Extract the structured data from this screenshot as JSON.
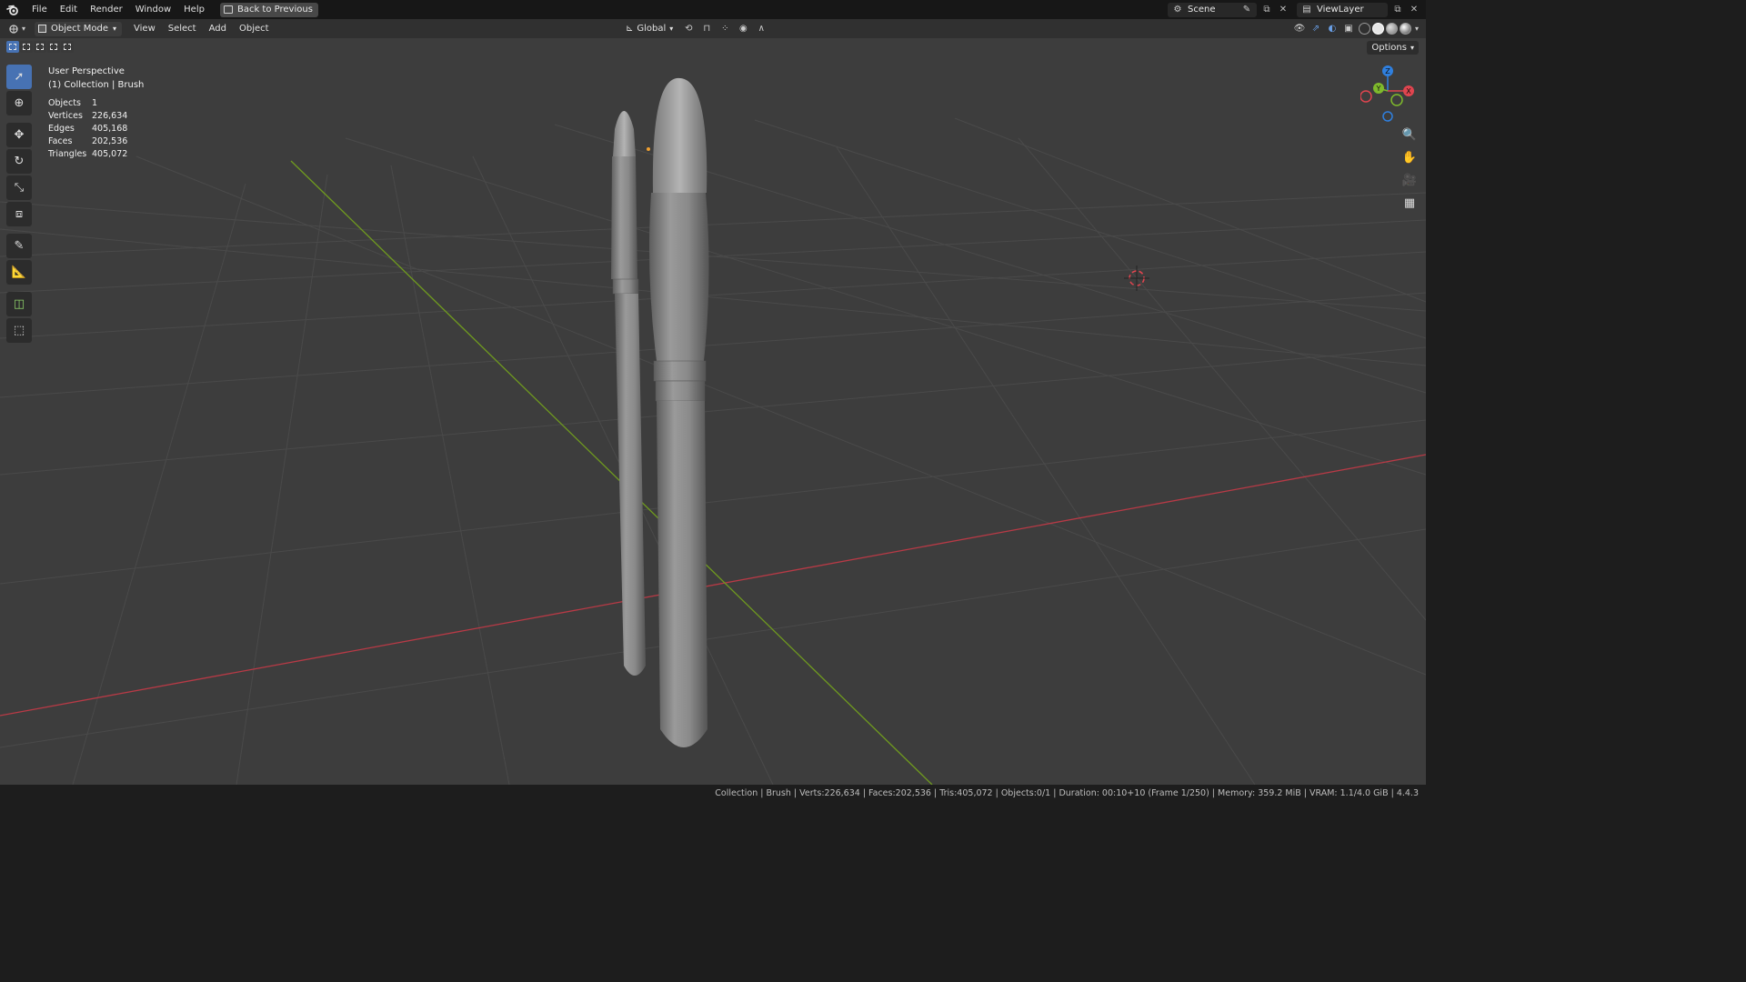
{
  "menubar": {
    "items": [
      "File",
      "Edit",
      "Render",
      "Window",
      "Help"
    ],
    "back_button": "Back to Previous",
    "scene_name": "Scene",
    "view_layer": "ViewLayer"
  },
  "viewport_header": {
    "mode": "Object Mode",
    "menus": [
      "View",
      "Select",
      "Add",
      "Object"
    ],
    "transform_orientation": "Global",
    "options_label": "Options"
  },
  "overlay": {
    "perspective": "User Perspective",
    "collection_info": "(1) Collection | Brush",
    "stats": [
      {
        "label": "Objects",
        "value": "1"
      },
      {
        "label": "Vertices",
        "value": "226,634"
      },
      {
        "label": "Edges",
        "value": "405,168"
      },
      {
        "label": "Faces",
        "value": "202,536"
      },
      {
        "label": "Triangles",
        "value": "405,072"
      }
    ]
  },
  "gizmo": {
    "x_label": "X",
    "y_label": "Y",
    "z_label": "Z",
    "x_color": "#e0454f",
    "y_color": "#7fba2c",
    "z_color": "#2f80e0"
  },
  "status_bar": "Collection | Brush | Verts:226,634 | Faces:202,536 | Tris:405,072 | Objects:0/1 | Duration: 00:10+10 (Frame 1/250) | Memory: 359.2 MiB | VRAM: 1.1/4.0 GiB | 4.4.3",
  "colors": {
    "accent": "#4772b3",
    "x_axis": "#b83a46",
    "y_axis": "#6f9a1f"
  }
}
